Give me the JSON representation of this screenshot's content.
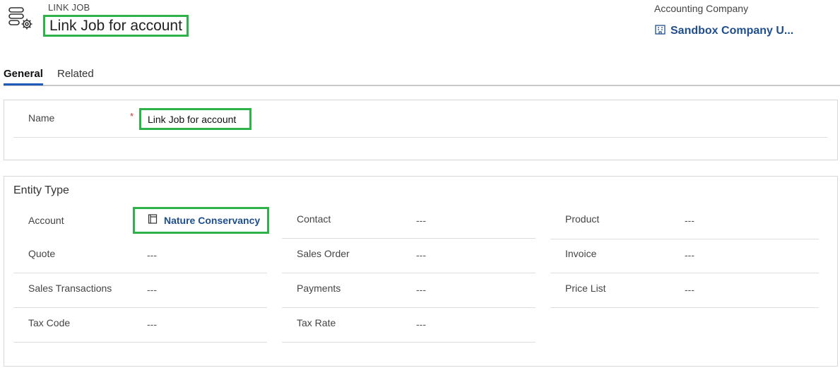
{
  "header": {
    "entity_kind": "LINK JOB",
    "title": "Link Job for account",
    "company_label": "Accounting Company",
    "company_name": "Sandbox Company U..."
  },
  "tabs": [
    {
      "label": "General",
      "active": true
    },
    {
      "label": "Related",
      "active": false
    }
  ],
  "name_section": {
    "label": "Name",
    "required_marker": "*",
    "value": "Link Job for account"
  },
  "entity_section": {
    "title": "Entity Type",
    "fields": [
      {
        "label": "Account",
        "value": "Nature Conservancy",
        "is_link": true
      },
      {
        "label": "Contact",
        "value": "---"
      },
      {
        "label": "Product",
        "value": "---"
      },
      {
        "label": "Quote",
        "value": "---"
      },
      {
        "label": "Sales Order",
        "value": "---"
      },
      {
        "label": "Invoice",
        "value": "---"
      },
      {
        "label": "Sales Transactions",
        "value": "---"
      },
      {
        "label": "Payments",
        "value": "---"
      },
      {
        "label": "Price List",
        "value": "---"
      },
      {
        "label": "Tax Code",
        "value": "---"
      },
      {
        "label": "Tax Rate",
        "value": "---"
      }
    ]
  },
  "colors": {
    "highlight": "#2db34a",
    "link": "#1f4e8c",
    "tab_accent": "#1f5bb8",
    "required": "#d13438"
  },
  "icons": [
    "entity-settings-icon",
    "company-record-icon",
    "account-record-icon"
  ]
}
